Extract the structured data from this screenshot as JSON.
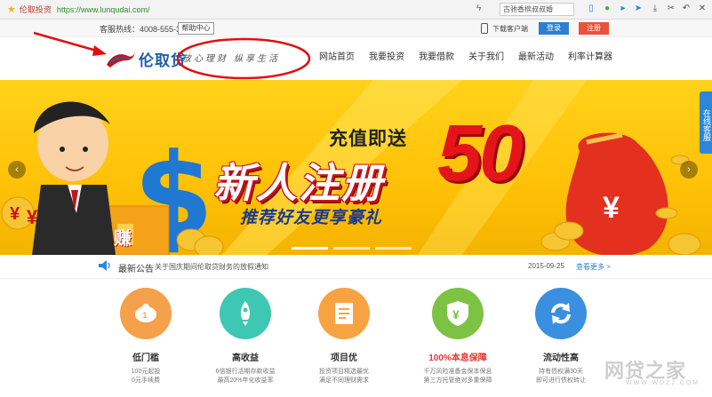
{
  "browser": {
    "site_name": "伦取投资",
    "url": "https://www.lunqudai.com/",
    "search_text": "古驰香槟叔叔婚",
    "tools": [
      "note-icon",
      "chat-icon",
      "play-icon",
      "send-icon",
      "download-icon",
      "cut-icon",
      "undo-icon",
      "close-icon"
    ]
  },
  "topbar": {
    "hotline": "客服热线：4008-555-355",
    "help": "帮助中心",
    "download": "下载客户端",
    "login": "登录",
    "register": "注册"
  },
  "header": {
    "logo_text": "伦取贷",
    "slogan": "放心理财 纵享生活",
    "nav": [
      "网站首页",
      "我要投资",
      "我要借款",
      "关于我们",
      "最新活动",
      "利率计算器"
    ]
  },
  "banner": {
    "title_sub": "充值即送",
    "title_main": "新人注册",
    "amount": "50",
    "title_note": "推荐好友更享豪礼",
    "money_symbol": "¥",
    "earn_char": "赚",
    "side_tab": "在线客服",
    "slides": 3,
    "active_slide": 1
  },
  "notice": {
    "label": "最新公告",
    "text": "关于国庆期间伦取贷财务的放假通知",
    "date": "2015-09-25",
    "more": "查看更多 >"
  },
  "features": [
    {
      "name": "低门槛",
      "desc": [
        "100元起投",
        "0元手续费"
      ],
      "color": "#f5a04a",
      "icon": "piggy-bank-icon"
    },
    {
      "name": "高收益",
      "desc": [
        "6倍银行活期存款收益",
        "最高20%年化收益率"
      ],
      "color": "#3ec7b3",
      "icon": "rocket-icon"
    },
    {
      "name": "项目优",
      "desc": [
        "投资项目精选最优",
        "满足不同理财需求"
      ],
      "color": "#f7a342",
      "icon": "document-icon"
    },
    {
      "name": "100%本息保障",
      "desc": [
        "千万风险准备金保本保息",
        "第三方托管绝对多重保障"
      ],
      "color": "#7cc243",
      "icon": "shield-yen-icon"
    },
    {
      "name": "流动性高",
      "desc": [
        "持有债权满30天",
        "即可进行债权转让"
      ],
      "color": "#3b8fe0",
      "icon": "refresh-icon"
    }
  ],
  "watermark": {
    "text": "网贷之家",
    "sub": "WWW.WDZJ.COM"
  }
}
